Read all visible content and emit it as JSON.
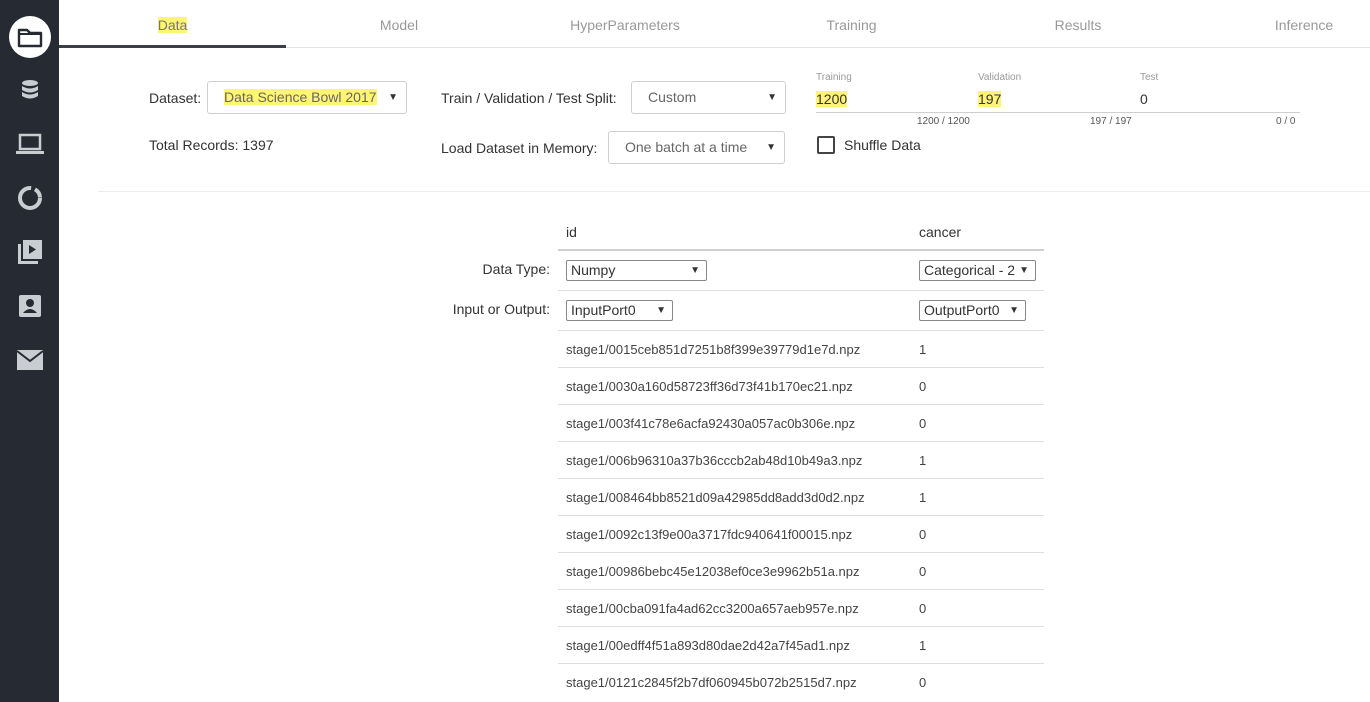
{
  "sidebar": {
    "items": [
      {
        "icon": "folder-icon",
        "active": true
      },
      {
        "icon": "database-icon",
        "active": false
      },
      {
        "icon": "laptop-icon",
        "active": false
      },
      {
        "icon": "circle-progress-icon",
        "active": false
      },
      {
        "icon": "video-library-icon",
        "active": false
      },
      {
        "icon": "contact-card-icon",
        "active": false
      },
      {
        "icon": "mail-icon",
        "active": false
      }
    ]
  },
  "tabs": [
    {
      "label": "Data",
      "active": true
    },
    {
      "label": "Model"
    },
    {
      "label": "HyperParameters"
    },
    {
      "label": "Training"
    },
    {
      "label": "Results"
    },
    {
      "label": "Inference"
    }
  ],
  "dataset": {
    "label": "Dataset:",
    "value": "Data Science Bowl 2017",
    "total_records": "Total Records: 1397"
  },
  "split": {
    "label": "Train / Validation / Test Split:",
    "value": "Custom",
    "training_label": "Training",
    "training_value": "1200",
    "training_ratio": "1200 / 1200",
    "validation_label": "Validation",
    "validation_value": "197",
    "validation_ratio": "197 / 197",
    "test_label": "Test",
    "test_value": "0",
    "test_ratio": "0 / 0"
  },
  "memory": {
    "label": "Load Dataset in Memory:",
    "value": "One batch at a time"
  },
  "shuffle": {
    "label": "Shuffle Data",
    "checked": false
  },
  "table": {
    "columns": [
      "id",
      "cancer"
    ],
    "data_type_label": "Data Type:",
    "data_types": [
      "Numpy",
      "Categorical - 2"
    ],
    "io_label": "Input or Output:",
    "ports": [
      "InputPort0",
      "OutputPort0"
    ],
    "rows": [
      [
        "stage1/0015ceb851d7251b8f399e39779d1e7d.npz",
        "1"
      ],
      [
        "stage1/0030a160d58723ff36d73f41b170ec21.npz",
        "0"
      ],
      [
        "stage1/003f41c78e6acfa92430a057ac0b306e.npz",
        "0"
      ],
      [
        "stage1/006b96310a37b36cccb2ab48d10b49a3.npz",
        "1"
      ],
      [
        "stage1/008464bb8521d09a42985dd8add3d0d2.npz",
        "1"
      ],
      [
        "stage1/0092c13f9e00a3717fdc940641f00015.npz",
        "0"
      ],
      [
        "stage1/00986bebc45e12038ef0ce3e9962b51a.npz",
        "0"
      ],
      [
        "stage1/00cba091fa4ad62cc3200a657aeb957e.npz",
        "0"
      ],
      [
        "stage1/00edff4f51a893d80dae2d42a7f45ad1.npz",
        "1"
      ],
      [
        "stage1/0121c2845f2b7df060945b072b2515d7.npz",
        "0"
      ]
    ]
  }
}
